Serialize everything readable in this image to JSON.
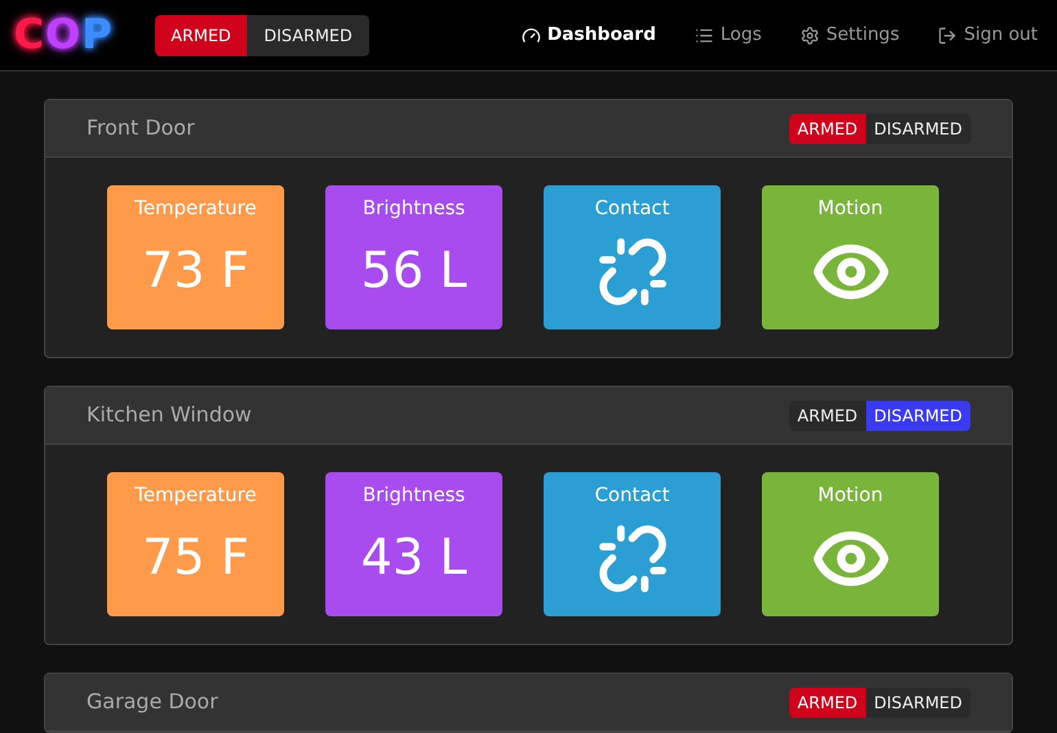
{
  "logo": [
    {
      "text": "C",
      "color": "#ff1a4a"
    },
    {
      "text": "O",
      "color": "#c040ff"
    },
    {
      "text": "P",
      "color": "#3a8cff"
    }
  ],
  "mode_toggle": [
    {
      "label": "ARMED",
      "selected": true
    },
    {
      "label": "DISARMED",
      "selected": false
    }
  ],
  "nav": [
    {
      "label": "Dashboard",
      "kind": "dashboard",
      "selected": true
    },
    {
      "label": "Logs",
      "kind": "logs",
      "selected": false
    },
    {
      "label": "Settings",
      "kind": "settings",
      "selected": false
    },
    {
      "label": "Sign out",
      "kind": "signout",
      "selected": false
    }
  ],
  "zones": [
    {
      "name": "Front Door",
      "toggle": [
        {
          "label": "ARMED",
          "selected": true
        },
        {
          "label": "DISARMED",
          "selected": false
        }
      ],
      "sensors": [
        {
          "kind": "temperature",
          "label": "Temperature",
          "value": "73 F"
        },
        {
          "kind": "brightness",
          "label": "Brightness",
          "value": "56 L"
        },
        {
          "kind": "contact",
          "label": "Contact"
        },
        {
          "kind": "motion",
          "label": "Motion"
        }
      ]
    },
    {
      "name": "Kitchen Window",
      "toggle": [
        {
          "label": "ARMED",
          "selected": false
        },
        {
          "label": "DISARMED",
          "selected": true
        }
      ],
      "sensors": [
        {
          "kind": "temperature",
          "label": "Temperature",
          "value": "75 F"
        },
        {
          "kind": "brightness",
          "label": "Brightness",
          "value": "43 L"
        },
        {
          "kind": "contact",
          "label": "Contact"
        },
        {
          "kind": "motion",
          "label": "Motion"
        }
      ]
    },
    {
      "name": "Garage Door",
      "toggle": [
        {
          "label": "ARMED",
          "selected": true
        },
        {
          "label": "DISARMED",
          "selected": false
        }
      ]
    }
  ]
}
